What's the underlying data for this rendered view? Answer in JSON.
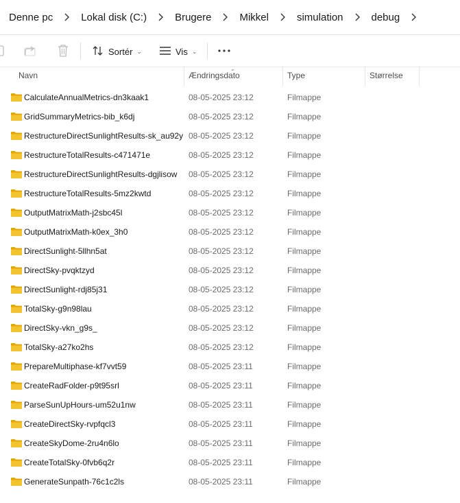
{
  "breadcrumb": [
    "Denne pc",
    "Lokal disk (C:)",
    "Brugere",
    "Mikkel",
    "simulation",
    "debug"
  ],
  "toolbar": {
    "sort_label": "Sortér",
    "view_label": "Vis",
    "icons": [
      "copy-icon",
      "share-icon",
      "delete-icon",
      "sort-icon",
      "view-icon",
      "more-icon"
    ]
  },
  "columns": {
    "name": "Navn",
    "date": "Ændringsdato",
    "type": "Type",
    "size": "Størrelse"
  },
  "files": [
    {
      "name": "CalculateAnnualMetrics-dn3kaak1",
      "date": "08-05-2025 23:12",
      "type": "Filmappe"
    },
    {
      "name": "GridSummaryMetrics-bib_k6dj",
      "date": "08-05-2025 23:12",
      "type": "Filmappe"
    },
    {
      "name": "RestructureDirectSunlightResults-sk_au92y",
      "date": "08-05-2025 23:12",
      "type": "Filmappe"
    },
    {
      "name": "RestructureTotalResults-c471471e",
      "date": "08-05-2025 23:12",
      "type": "Filmappe"
    },
    {
      "name": "RestructureDirectSunlightResults-dgjlisow",
      "date": "08-05-2025 23:12",
      "type": "Filmappe"
    },
    {
      "name": "RestructureTotalResults-5mz2kwtd",
      "date": "08-05-2025 23:12",
      "type": "Filmappe"
    },
    {
      "name": "OutputMatrixMath-j2sbc45l",
      "date": "08-05-2025 23:12",
      "type": "Filmappe"
    },
    {
      "name": "OutputMatrixMath-k0ex_3h0",
      "date": "08-05-2025 23:12",
      "type": "Filmappe"
    },
    {
      "name": "DirectSunlight-5llhn5at",
      "date": "08-05-2025 23:12",
      "type": "Filmappe"
    },
    {
      "name": "DirectSky-pvqktzyd",
      "date": "08-05-2025 23:12",
      "type": "Filmappe"
    },
    {
      "name": "DirectSunlight-rdj85j31",
      "date": "08-05-2025 23:12",
      "type": "Filmappe"
    },
    {
      "name": "TotalSky-g9n98lau",
      "date": "08-05-2025 23:12",
      "type": "Filmappe"
    },
    {
      "name": "DirectSky-vkn_g9s_",
      "date": "08-05-2025 23:12",
      "type": "Filmappe"
    },
    {
      "name": "TotalSky-a27ko2hs",
      "date": "08-05-2025 23:12",
      "type": "Filmappe"
    },
    {
      "name": "PrepareMultiphase-kf7vvt59",
      "date": "08-05-2025 23:11",
      "type": "Filmappe"
    },
    {
      "name": "CreateRadFolder-p9t95srl",
      "date": "08-05-2025 23:11",
      "type": "Filmappe"
    },
    {
      "name": "ParseSunUpHours-um52u1nw",
      "date": "08-05-2025 23:11",
      "type": "Filmappe"
    },
    {
      "name": "CreateDirectSky-rvpfqcl3",
      "date": "08-05-2025 23:11",
      "type": "Filmappe"
    },
    {
      "name": "CreateSkyDome-2ru4n6lo",
      "date": "08-05-2025 23:11",
      "type": "Filmappe"
    },
    {
      "name": "CreateTotalSky-0fvb6q2r",
      "date": "08-05-2025 23:11",
      "type": "Filmappe"
    },
    {
      "name": "GenerateSunpath-76c1c2ls",
      "date": "08-05-2025 23:11",
      "type": "Filmappe"
    }
  ],
  "colors": {
    "folder": "#f4c430",
    "folder_dark": "#e0a800",
    "text": "#1a1a1a",
    "muted": "#6b6b6b"
  }
}
